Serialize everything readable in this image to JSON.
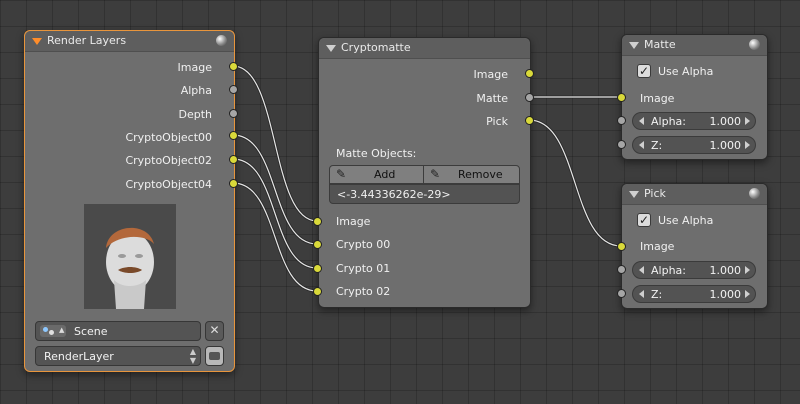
{
  "render_layers": {
    "title": "Render Layers",
    "outputs": [
      "Image",
      "Alpha",
      "Depth",
      "CryptoObject00",
      "CryptoObject02",
      "CryptoObject04"
    ],
    "scene_value": "Scene",
    "layer_value": "RenderLayer"
  },
  "cryptomatte": {
    "title": "Cryptomatte",
    "outputs": [
      "Image",
      "Matte",
      "Pick"
    ],
    "matte_objects_label": "Matte Objects:",
    "add_label": "Add",
    "remove_label": "Remove",
    "matte_id_value": "<-3.44336262e-29>",
    "inputs": [
      "Image",
      "Crypto 00",
      "Crypto 01",
      "Crypto 02"
    ]
  },
  "matte": {
    "title": "Matte",
    "use_alpha_label": "Use Alpha",
    "use_alpha_checked": true,
    "image_label": "Image",
    "alpha_label": "Alpha:",
    "alpha_value": "1.000",
    "z_label": "Z:",
    "z_value": "1.000"
  },
  "pick": {
    "title": "Pick",
    "use_alpha_label": "Use Alpha",
    "use_alpha_checked": true,
    "image_label": "Image",
    "alpha_label": "Alpha:",
    "alpha_value": "1.000",
    "z_label": "Z:",
    "z_value": "1.000"
  },
  "colors": {
    "active_outline": "#e8953c",
    "socket_color": "#d9d93a",
    "socket_value": "#a6a6a6"
  }
}
